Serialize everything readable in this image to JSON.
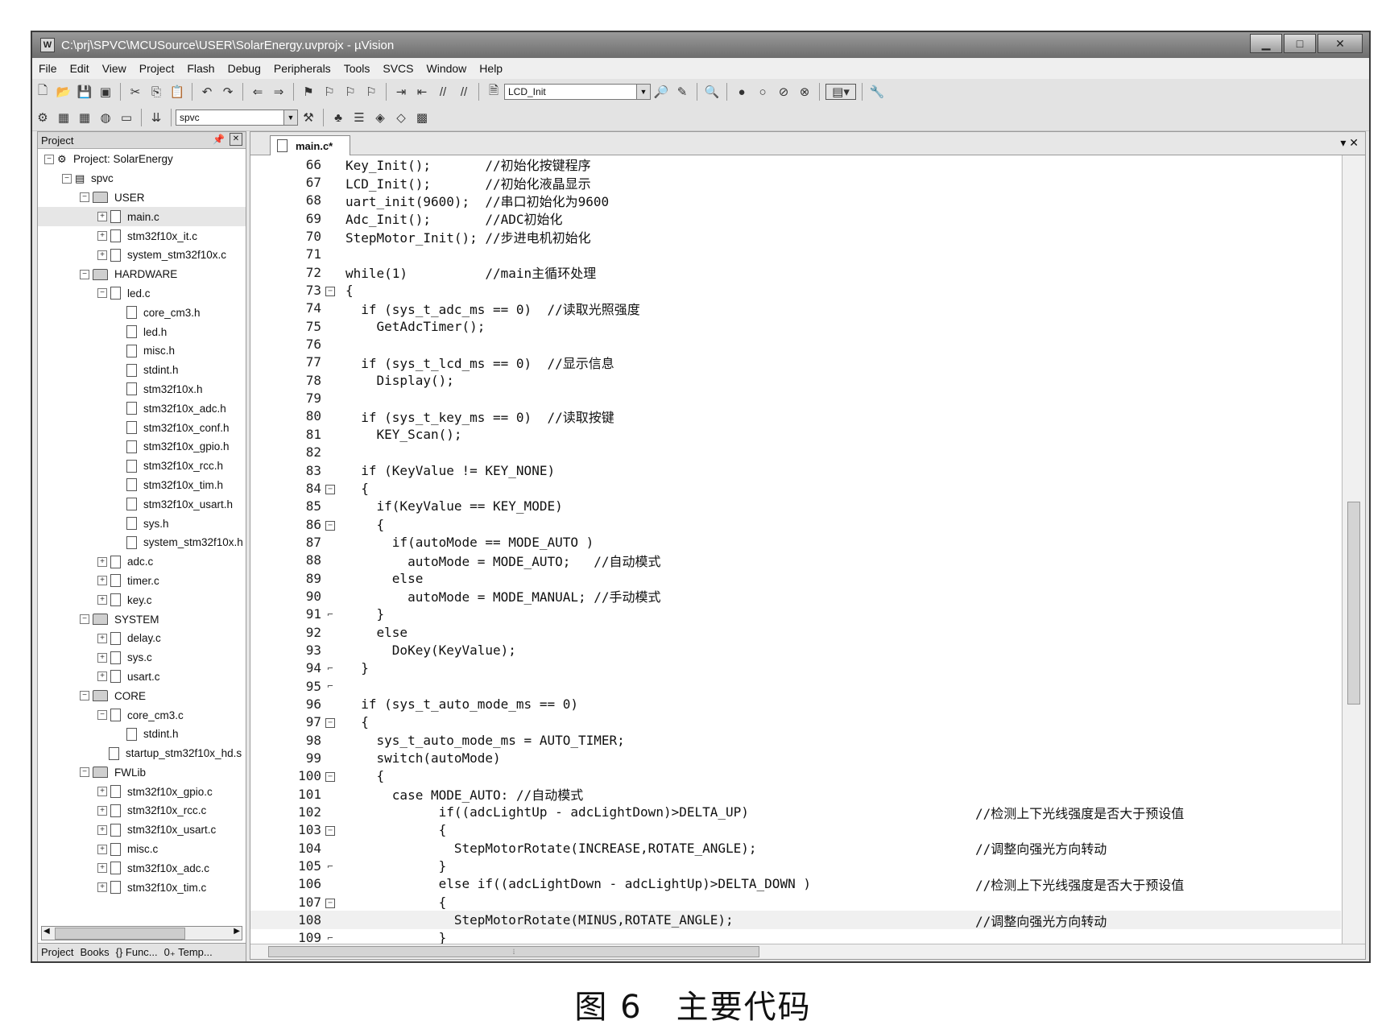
{
  "window": {
    "title": "C:\\prj\\SPVC\\MCUSource\\USER\\SolarEnergy.uvprojx - µVision",
    "app_icon": "keil-logo-icon"
  },
  "window_buttons": {
    "minimize": "▁",
    "maximize": "□",
    "close": "✕"
  },
  "menu": [
    "File",
    "Edit",
    "View",
    "Project",
    "Flash",
    "Debug",
    "Peripherals",
    "Tools",
    "SVCS",
    "Window",
    "Help"
  ],
  "toolbar1": {
    "target_function": "LCD_Init"
  },
  "toolbar2": {
    "target": "spvc"
  },
  "project_panel": {
    "title": "Project",
    "tree": [
      {
        "depth": 0,
        "kind": "project",
        "toggle": "⊟",
        "label": "Project: SolarEnergy"
      },
      {
        "depth": 1,
        "kind": "target",
        "toggle": "⊟",
        "label": "spvc"
      },
      {
        "depth": 2,
        "kind": "folder",
        "toggle": "⊟",
        "label": "USER"
      },
      {
        "depth": 3,
        "kind": "file",
        "toggle": "⊞",
        "label": "main.c",
        "selected": true
      },
      {
        "depth": 3,
        "kind": "file",
        "toggle": "⊞",
        "label": "stm32f10x_it.c"
      },
      {
        "depth": 3,
        "kind": "file",
        "toggle": "⊞",
        "label": "system_stm32f10x.c"
      },
      {
        "depth": 2,
        "kind": "folder",
        "toggle": "⊟",
        "label": "HARDWARE"
      },
      {
        "depth": 3,
        "kind": "file",
        "toggle": "⊟",
        "label": "led.c"
      },
      {
        "depth": 4,
        "kind": "file",
        "toggle": "",
        "label": "core_cm3.h"
      },
      {
        "depth": 4,
        "kind": "file",
        "toggle": "",
        "label": "led.h"
      },
      {
        "depth": 4,
        "kind": "file",
        "toggle": "",
        "label": "misc.h"
      },
      {
        "depth": 4,
        "kind": "file",
        "toggle": "",
        "label": "stdint.h"
      },
      {
        "depth": 4,
        "kind": "file",
        "toggle": "",
        "label": "stm32f10x.h"
      },
      {
        "depth": 4,
        "kind": "file",
        "toggle": "",
        "label": "stm32f10x_adc.h"
      },
      {
        "depth": 4,
        "kind": "file",
        "toggle": "",
        "label": "stm32f10x_conf.h"
      },
      {
        "depth": 4,
        "kind": "file",
        "toggle": "",
        "label": "stm32f10x_gpio.h"
      },
      {
        "depth": 4,
        "kind": "file",
        "toggle": "",
        "label": "stm32f10x_rcc.h"
      },
      {
        "depth": 4,
        "kind": "file",
        "toggle": "",
        "label": "stm32f10x_tim.h"
      },
      {
        "depth": 4,
        "kind": "file",
        "toggle": "",
        "label": "stm32f10x_usart.h"
      },
      {
        "depth": 4,
        "kind": "file",
        "toggle": "",
        "label": "sys.h"
      },
      {
        "depth": 4,
        "kind": "file",
        "toggle": "",
        "label": "system_stm32f10x.h"
      },
      {
        "depth": 3,
        "kind": "file",
        "toggle": "⊞",
        "label": "adc.c"
      },
      {
        "depth": 3,
        "kind": "file",
        "toggle": "⊞",
        "label": "timer.c"
      },
      {
        "depth": 3,
        "kind": "file",
        "toggle": "⊞",
        "label": "key.c"
      },
      {
        "depth": 2,
        "kind": "folder",
        "toggle": "⊟",
        "label": "SYSTEM"
      },
      {
        "depth": 3,
        "kind": "file",
        "toggle": "⊞",
        "label": "delay.c"
      },
      {
        "depth": 3,
        "kind": "file",
        "toggle": "⊞",
        "label": "sys.c"
      },
      {
        "depth": 3,
        "kind": "file",
        "toggle": "⊞",
        "label": "usart.c"
      },
      {
        "depth": 2,
        "kind": "folder",
        "toggle": "⊟",
        "label": "CORE"
      },
      {
        "depth": 3,
        "kind": "file",
        "toggle": "⊟",
        "label": "core_cm3.c"
      },
      {
        "depth": 4,
        "kind": "file",
        "toggle": "",
        "label": "stdint.h"
      },
      {
        "depth": 3,
        "kind": "file",
        "toggle": "",
        "label": "startup_stm32f10x_hd.s"
      },
      {
        "depth": 2,
        "kind": "folder",
        "toggle": "⊟",
        "label": "FWLib"
      },
      {
        "depth": 3,
        "kind": "file",
        "toggle": "⊞",
        "label": "stm32f10x_gpio.c"
      },
      {
        "depth": 3,
        "kind": "file",
        "toggle": "⊞",
        "label": "stm32f10x_rcc.c"
      },
      {
        "depth": 3,
        "kind": "file",
        "toggle": "⊞",
        "label": "stm32f10x_usart.c"
      },
      {
        "depth": 3,
        "kind": "file",
        "toggle": "⊞",
        "label": "misc.c"
      },
      {
        "depth": 3,
        "kind": "file",
        "toggle": "⊞",
        "label": "stm32f10x_adc.c"
      },
      {
        "depth": 3,
        "kind": "file",
        "toggle": "⊞",
        "label": "stm32f10x_tim.c"
      }
    ],
    "bottom_tabs": [
      "Project",
      "Books",
      "{} Func...",
      "0₊ Temp..."
    ]
  },
  "editor": {
    "tab_label": "main.c*",
    "tab_controls": "▾ ✕",
    "lines": [
      {
        "n": "66",
        "fold": "",
        "code": "Key_Init();       //初始化按键程序",
        "comment": ""
      },
      {
        "n": "67",
        "fold": "",
        "code": "LCD_Init();       //初始化液晶显示",
        "comment": ""
      },
      {
        "n": "68",
        "fold": "",
        "code": "uart_init(9600);  //串口初始化为9600",
        "comment": ""
      },
      {
        "n": "69",
        "fold": "",
        "code": "Adc_Init();       //ADC初始化",
        "comment": ""
      },
      {
        "n": "70",
        "fold": "",
        "code": "StepMotor_Init(); //步进电机初始化",
        "comment": ""
      },
      {
        "n": "71",
        "fold": "",
        "code": "",
        "comment": ""
      },
      {
        "n": "72",
        "fold": "",
        "code": "while(1)          //main主循环处理",
        "comment": ""
      },
      {
        "n": "73",
        "fold": "box",
        "code": "{",
        "comment": ""
      },
      {
        "n": "74",
        "fold": "",
        "code": "  if (sys_t_adc_ms == 0)  //读取光照强度",
        "comment": ""
      },
      {
        "n": "75",
        "fold": "",
        "code": "    GetAdcTimer();",
        "comment": ""
      },
      {
        "n": "76",
        "fold": "",
        "code": "",
        "comment": ""
      },
      {
        "n": "77",
        "fold": "",
        "code": "  if (sys_t_lcd_ms == 0)  //显示信息",
        "comment": ""
      },
      {
        "n": "78",
        "fold": "",
        "code": "    Display();",
        "comment": ""
      },
      {
        "n": "79",
        "fold": "",
        "code": "",
        "comment": ""
      },
      {
        "n": "80",
        "fold": "",
        "code": "  if (sys_t_key_ms == 0)  //读取按键",
        "comment": ""
      },
      {
        "n": "81",
        "fold": "",
        "code": "    KEY_Scan();",
        "comment": ""
      },
      {
        "n": "82",
        "fold": "",
        "code": "",
        "comment": ""
      },
      {
        "n": "83",
        "fold": "",
        "code": "  if (KeyValue != KEY_NONE)",
        "comment": ""
      },
      {
        "n": "84",
        "fold": "box",
        "code": "  {",
        "comment": ""
      },
      {
        "n": "85",
        "fold": "",
        "code": "    if(KeyValue == KEY_MODE)",
        "comment": ""
      },
      {
        "n": "86",
        "fold": "box",
        "code": "    {",
        "comment": ""
      },
      {
        "n": "87",
        "fold": "",
        "code": "      if(autoMode == MODE_AUTO )",
        "comment": ""
      },
      {
        "n": "88",
        "fold": "",
        "code": "        autoMode = MODE_AUTO;   //自动模式",
        "comment": ""
      },
      {
        "n": "89",
        "fold": "",
        "code": "      else",
        "comment": ""
      },
      {
        "n": "90",
        "fold": "",
        "code": "        autoMode = MODE_MANUAL; //手动模式",
        "comment": ""
      },
      {
        "n": "91",
        "fold": "end",
        "code": "    }",
        "comment": ""
      },
      {
        "n": "92",
        "fold": "",
        "code": "    else",
        "comment": ""
      },
      {
        "n": "93",
        "fold": "",
        "code": "      DoKey(KeyValue);",
        "comment": ""
      },
      {
        "n": "94",
        "fold": "end",
        "code": "  }",
        "comment": ""
      },
      {
        "n": "95",
        "fold": "end",
        "code": "",
        "comment": ""
      },
      {
        "n": "96",
        "fold": "",
        "code": "  if (sys_t_auto_mode_ms == 0)",
        "comment": ""
      },
      {
        "n": "97",
        "fold": "box",
        "code": "  {",
        "comment": ""
      },
      {
        "n": "98",
        "fold": "",
        "code": "    sys_t_auto_mode_ms = AUTO_TIMER;",
        "comment": ""
      },
      {
        "n": "99",
        "fold": "",
        "code": "    switch(autoMode)",
        "comment": ""
      },
      {
        "n": "100",
        "fold": "box",
        "code": "    {",
        "comment": ""
      },
      {
        "n": "101",
        "fold": "",
        "code": "      case MODE_AUTO: //自动模式",
        "comment": ""
      },
      {
        "n": "102",
        "fold": "",
        "code": "            if((adcLightUp - adcLightDown)>DELTA_UP)",
        "comment": "//检测上下光线强度是否大于预设值"
      },
      {
        "n": "103",
        "fold": "box",
        "code": "            {",
        "comment": ""
      },
      {
        "n": "104",
        "fold": "",
        "code": "              StepMotorRotate(INCREASE,ROTATE_ANGLE);",
        "comment": "//调整向强光方向转动"
      },
      {
        "n": "105",
        "fold": "end",
        "code": "            }",
        "comment": ""
      },
      {
        "n": "106",
        "fold": "",
        "code": "            else if((adcLightDown - adcLightUp)>DELTA_DOWN )",
        "comment": "//检测上下光线强度是否大于预设值"
      },
      {
        "n": "107",
        "fold": "box",
        "code": "            {",
        "comment": ""
      },
      {
        "n": "108",
        "fold": "",
        "code": "              StepMotorRotate(MINUS,ROTATE_ANGLE);",
        "comment": "//调整向强光方向转动",
        "current": true
      },
      {
        "n": "109",
        "fold": "end",
        "code": "            }",
        "comment": ""
      }
    ]
  },
  "caption": "图 6　主要代码"
}
